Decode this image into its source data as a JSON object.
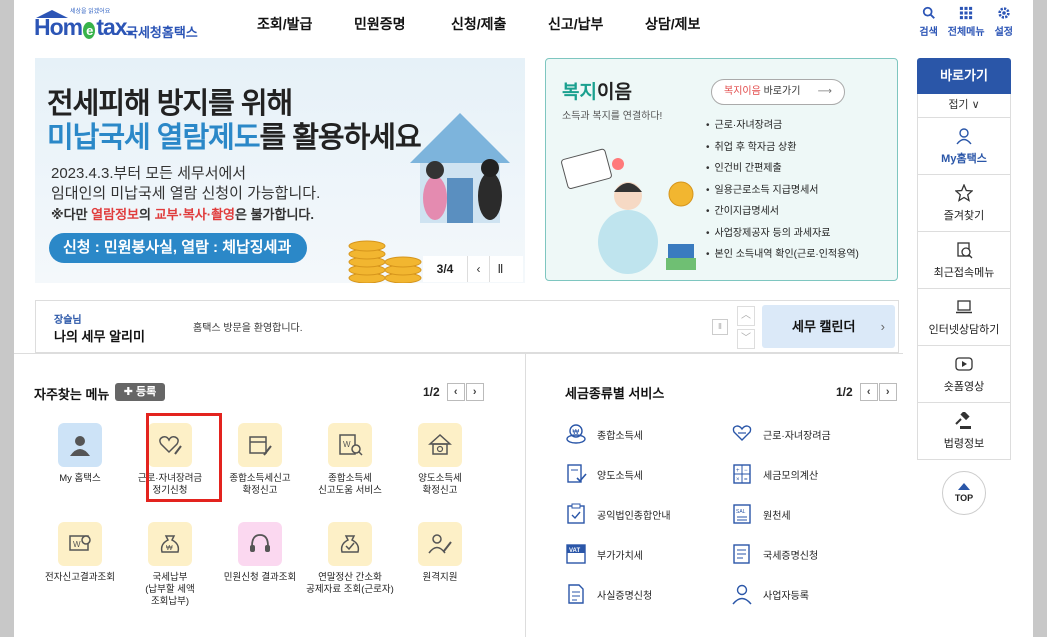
{
  "header": {
    "logo_tagline": "세상을 읽겠어요",
    "logo_main_left": "Hom",
    "logo_main_e": "e",
    "logo_main_right": "tax.",
    "logo_sub": "국세청홈택스",
    "nav": [
      "조회/발급",
      "민원증명",
      "신청/제출",
      "신고/납부",
      "상담/제보"
    ],
    "utils": [
      {
        "label": "검색",
        "icon": "search-icon"
      },
      {
        "label": "전체메뉴",
        "icon": "grid-icon"
      },
      {
        "label": "설정",
        "icon": "gear-icon"
      }
    ]
  },
  "banner": {
    "title1": "전세피해 방지를 위해",
    "title2_hl": "미납국세 열람제도",
    "title2_rest": "를 활용하세요",
    "line1": "2023.4.3.부터 모든 세무서에서",
    "line2": "임대인의 미납국세 열람 신청이 가능합니다.",
    "line3_pre": "※다만 ",
    "line3_red1": "열람정보",
    "line3_mid": "의 ",
    "line3_red2": "교부·복사·촬영",
    "line3_post": "은 불가합니다.",
    "pill": "신청 : 민원봉사실,  열람 : 체납징세과",
    "counter": "3/4",
    "prev": "‹",
    "pause": "Ⅱ"
  },
  "welfare": {
    "title_hl": "복지",
    "title_rest": "이음",
    "subtitle": "소득과 복지를 연결하다!",
    "btn_hl": "복지이음",
    "btn_rest": " 바로가기",
    "btn_arrow": "⟶",
    "items": [
      "근로·자녀장려금",
      "취업 후 학자금 상환",
      "인건비 간편제출",
      "일용근로소득 지급명세서",
      "간이지급명세서",
      "사업장제공자 등의 과세자료",
      "본인 소득내역 확인(근로·인적용역)"
    ]
  },
  "side": {
    "header": "바로가기",
    "fold": "접기 ∨",
    "items": [
      {
        "label": "My홈택스",
        "icon": "person-icon",
        "active": true
      },
      {
        "label": "즐겨찾기",
        "icon": "star-icon",
        "active": false
      },
      {
        "label": "최근접속메뉴",
        "icon": "recent-icon",
        "active": false
      },
      {
        "label": "인터넷상담하기",
        "icon": "laptop-icon",
        "active": false
      },
      {
        "label": "숏폼영상",
        "icon": "play-icon",
        "active": false
      },
      {
        "label": "법령정보",
        "icon": "gavel-icon",
        "active": false
      }
    ],
    "top": "TOP"
  },
  "notice": {
    "user": "장슬님",
    "title": "나의 세무 알리미",
    "message": "홈택스 방문을 환영합니다.",
    "pause": "Ⅱ",
    "up": "︿",
    "down": "﹀",
    "calendar": "세무 캘린더",
    "calendar_chev": "›"
  },
  "favorites": {
    "title": "자주찾는 메뉴",
    "add": "✚ 등록",
    "page": "1/2",
    "items": [
      {
        "label": "My 홈택스",
        "icon": "user-card-icon",
        "bg": "#cde3f7"
      },
      {
        "label": "근로·자녀장려금\n정기신청",
        "icon": "heart-pen-icon",
        "bg": "#fdf0c7"
      },
      {
        "label": "종합소득세신고\n확정신고",
        "icon": "calendar-pen-icon",
        "bg": "#fdf0c7"
      },
      {
        "label": "종합소득세\n신고도움 서비스",
        "icon": "doc-search-icon",
        "bg": "#fdf0c7"
      },
      {
        "label": "양도소득세\n확정신고",
        "icon": "house-icon",
        "bg": "#fdf0c7"
      },
      {
        "label": "전자신고결과조회",
        "icon": "doc-magnify-icon",
        "bg": "#fdf0c7"
      },
      {
        "label": "국세납부\n(납부할 세액\n조회납부)",
        "icon": "money-bag-icon",
        "bg": "#fdf0c7"
      },
      {
        "label": "민원신청 결과조회",
        "icon": "headset-icon",
        "bg": "#fbd8f0"
      },
      {
        "label": "연말정산 간소화\n공제자료 조회(근로자)",
        "icon": "money-bag-check-icon",
        "bg": "#fdf0c7"
      },
      {
        "label": "원격지원",
        "icon": "person-pen-icon",
        "bg": "#fdf0c7"
      }
    ]
  },
  "tax_services": {
    "title": "세금종류별 서비스",
    "page": "1/2",
    "items": [
      {
        "label": "종합소득세",
        "icon": "coin-won-icon"
      },
      {
        "label": "근로·자녀장려금",
        "icon": "heart-hand-icon"
      },
      {
        "label": "양도소득세",
        "icon": "doc-check-icon"
      },
      {
        "label": "세금모의계산",
        "icon": "calculator-icon"
      },
      {
        "label": "공익법인종합안내",
        "icon": "clipboard-icon"
      },
      {
        "label": "원천세",
        "icon": "salary-doc-icon"
      },
      {
        "label": "부가가치세",
        "icon": "vat-icon"
      },
      {
        "label": "국세증명신청",
        "icon": "certificate-icon"
      },
      {
        "label": "사실증명신청",
        "icon": "document-icon"
      },
      {
        "label": "사업자등록",
        "icon": "user-register-icon"
      }
    ]
  }
}
